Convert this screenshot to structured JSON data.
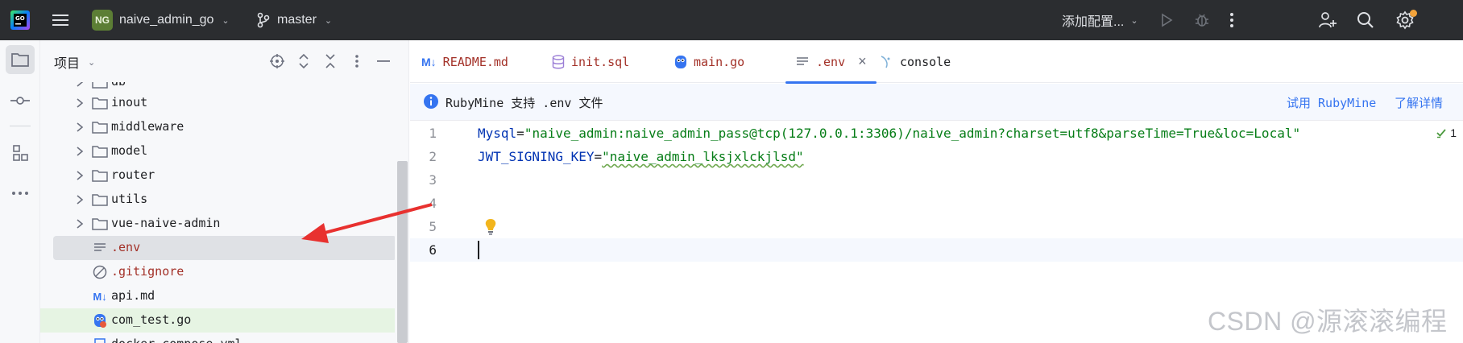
{
  "titlebar": {
    "project_badge": "NG",
    "project_name": "naive_admin_go",
    "branch": "master",
    "run_config": "添加配置..."
  },
  "sidebar": {
    "title": "项目",
    "tree": [
      {
        "label": "db",
        "type": "folder",
        "expandable": true
      },
      {
        "label": "inout",
        "type": "folder",
        "expandable": true
      },
      {
        "label": "middleware",
        "type": "folder",
        "expandable": true
      },
      {
        "label": "model",
        "type": "folder",
        "expandable": true
      },
      {
        "label": "router",
        "type": "folder",
        "expandable": true
      },
      {
        "label": "utils",
        "type": "folder",
        "expandable": true
      },
      {
        "label": "vue-naive-admin",
        "type": "folder",
        "expandable": true
      },
      {
        "label": ".env",
        "type": "text-file",
        "selected": true
      },
      {
        "label": ".gitignore",
        "type": "ignore-file"
      },
      {
        "label": "api.md",
        "type": "markdown-file"
      },
      {
        "label": "com_test.go",
        "type": "go-test-file"
      },
      {
        "label": "docker-compose.yml",
        "type": "yaml-file"
      }
    ]
  },
  "tabs": [
    {
      "label": "README.md",
      "icon": "markdown-icon"
    },
    {
      "label": "init.sql",
      "icon": "database-icon"
    },
    {
      "label": "main.go",
      "icon": "gopher-icon"
    },
    {
      "label": ".env",
      "icon": "text-file-icon",
      "active": true
    },
    {
      "label": "console",
      "icon": "console-icon"
    }
  ],
  "notice": {
    "text": "RubyMine 支持 .env 文件",
    "try_link": "试用 RubyMine",
    "learn_link": "了解详情"
  },
  "editor": {
    "lines": [
      {
        "num": "1",
        "key": "Mysql",
        "eq": "=",
        "value": "\"naive_admin:naive_admin_pass@tcp(127.0.0.1:3306)/naive_admin?charset=utf8&parseTime=True&loc=Local\""
      },
      {
        "num": "2",
        "key": "JWT_SIGNING_KEY",
        "eq": "=",
        "value": "\"naive_admin_lksjxlckjlsd\""
      },
      {
        "num": "3"
      },
      {
        "num": "4"
      },
      {
        "num": "5"
      },
      {
        "num": "6"
      }
    ],
    "inspection_count": "1"
  },
  "watermark": "CSDN @源滚滚编程",
  "colors": {
    "accent": "#3574f0",
    "key": "#0033b3",
    "string": "#067d17",
    "annotation_arrow": "#e8312f"
  }
}
